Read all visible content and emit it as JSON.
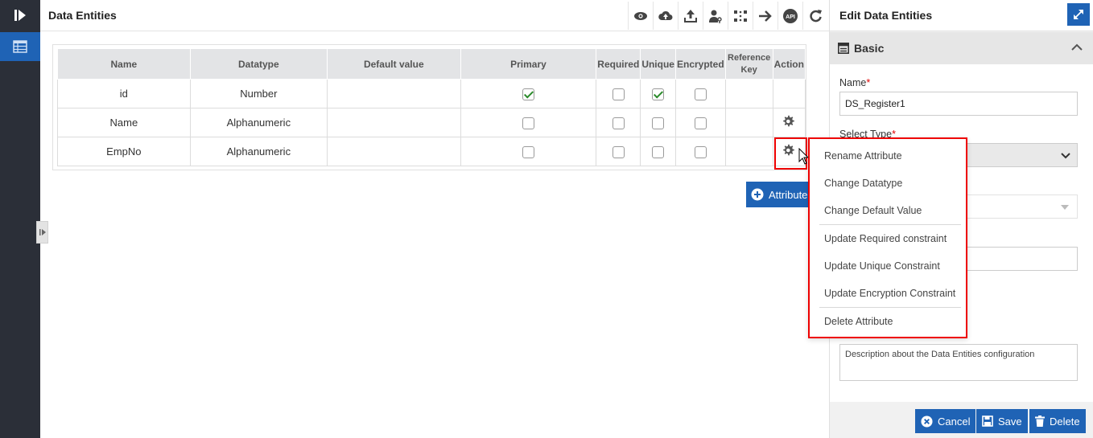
{
  "main": {
    "title": "Data Entities",
    "toolbar": [
      "eye-icon",
      "cloud-upload-icon",
      "upload-icon",
      "user-key-icon",
      "grid-dots-icon",
      "arrow-right-icon",
      "api-icon",
      "refresh-icon"
    ],
    "api_label": "API",
    "table": {
      "headers": [
        "Name",
        "Datatype",
        "Default value",
        "Primary",
        "Required",
        "Unique",
        "Encrypted",
        "Reference Key",
        "Action"
      ],
      "rows": [
        {
          "name": "id",
          "datatype": "Number",
          "default": "",
          "primary": true,
          "required": false,
          "unique": true,
          "encrypted": false
        },
        {
          "name": "Name",
          "datatype": "Alphanumeric",
          "default": "",
          "primary": false,
          "required": false,
          "unique": false,
          "encrypted": false
        },
        {
          "name": "EmpNo",
          "datatype": "Alphanumeric",
          "default": "",
          "primary": false,
          "required": false,
          "unique": false,
          "encrypted": false
        }
      ]
    },
    "add_attribute_label": "Attribute"
  },
  "context_menu": {
    "items": [
      "Rename Attribute",
      "Change Datatype",
      "Change Default Value",
      "Update Required constraint",
      "Update Unique Constraint",
      "Update Encryption Constraint",
      "Delete Attribute"
    ]
  },
  "panel": {
    "title": "Edit Data Entities",
    "section": "Basic",
    "name_label": "Name",
    "name_value": "DS_Register1",
    "type_label": "Select Type",
    "description_value": "Description about the Data Entities configuration",
    "buttons": {
      "cancel": "Cancel",
      "save": "Save",
      "delete": "Delete"
    }
  },
  "colors": {
    "accent": "#1f63b5",
    "highlight": "#e00000",
    "rail": "#2b2f38"
  }
}
